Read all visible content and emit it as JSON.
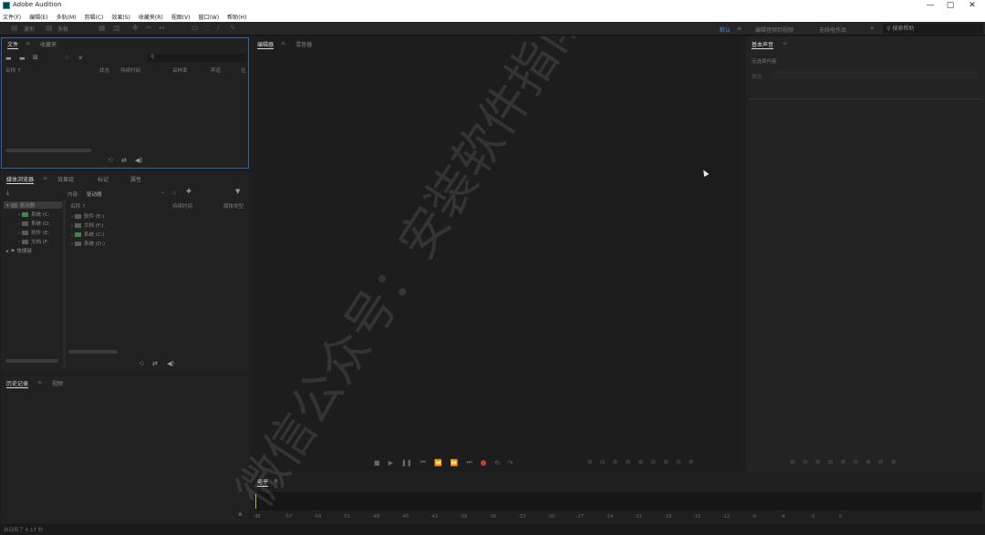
{
  "window": {
    "title": "Adobe Audition",
    "controls": {
      "minimize": "—",
      "maximize": "▢",
      "close": "✕"
    }
  },
  "menubar": {
    "items": [
      "文件(F)",
      "编辑(E)",
      "多轨(M)",
      "剪辑(C)",
      "效果(S)",
      "收藏夹(R)",
      "视图(V)",
      "窗口(W)",
      "帮助(H)"
    ]
  },
  "toolbar": {
    "waveform_label": "波形",
    "multitrack_label": "多轨",
    "workspace_active": "默认",
    "workspace_menu": "≡",
    "workspace_2": "编辑音频到视频",
    "workspace_3": "无线电作品",
    "overflow": "»",
    "search_placeholder": "搜索帮助"
  },
  "files_panel": {
    "tabs": [
      "文件",
      "收藏夹"
    ],
    "columns": [
      "名称 ↑",
      "状态",
      "持续时间",
      "采样率",
      "声道",
      "位"
    ]
  },
  "media_browser": {
    "tabs": [
      "媒体浏览器",
      "效果组",
      "标记",
      "属性"
    ],
    "content_label": "内容:",
    "content_value": "驱动器",
    "left_tree": [
      {
        "label": "驱动器",
        "level": 0,
        "arrow": "▾"
      },
      {
        "label": "系统 (C:",
        "level": 1,
        "arrow": "›"
      },
      {
        "label": "系统 (D:",
        "level": 1,
        "arrow": "›"
      },
      {
        "label": "软件 (E:",
        "level": 1,
        "arrow": "›"
      },
      {
        "label": "文档 (F:",
        "level": 1,
        "arrow": "›"
      },
      {
        "label": "快捷键",
        "level": 0,
        "arrow": "▸"
      }
    ],
    "right_columns": [
      "名称 ↑",
      "持续时间",
      "媒体类型"
    ],
    "right_items": [
      "软件 (E:)",
      "文档 (F:)",
      "系统 (C:)",
      "系统 (D:)"
    ]
  },
  "history_panel": {
    "tabs": [
      "历史记录",
      "视频"
    ]
  },
  "editor": {
    "tabs": [
      "编辑器",
      "混音器"
    ]
  },
  "essential_sound": {
    "tab": "基本声音",
    "no_selection": "无选择内容",
    "preset_label": "预设:"
  },
  "level_panel": {
    "tab": "电平",
    "scale": [
      "dB",
      "-57",
      "-54",
      "-51",
      "-48",
      "-45",
      "-42",
      "-39",
      "-36",
      "-33",
      "-30",
      "-27",
      "-24",
      "-21",
      "-18",
      "-15",
      "-12",
      "-9",
      "-6",
      "-3",
      "0"
    ]
  },
  "statusbar": {
    "text": "启动用了 6.17 秒"
  },
  "watermark": {
    "text": "微信公众号：安装软件指南"
  },
  "colors": {
    "accent_blue": "#2c64a7",
    "record_red": "#d23a3a",
    "panel_bg": "#212121"
  }
}
